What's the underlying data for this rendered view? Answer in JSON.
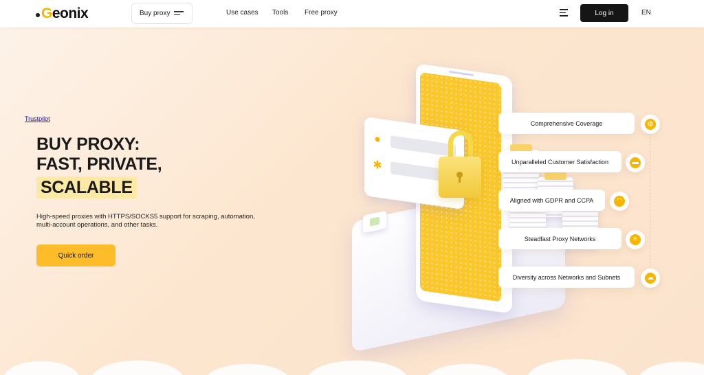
{
  "header": {
    "logo_g": "G",
    "logo_rest": "eonix",
    "buy_proxy_label": "Buy proxy",
    "nav": [
      "Use cases",
      "Tools",
      "Free proxy"
    ],
    "login_label": "Log in",
    "lang": "EN"
  },
  "hero": {
    "trustpilot": "Trustpilot",
    "title_line1": "BUY PROXY:",
    "title_line2": "FAST, PRIVATE,",
    "title_highlight": "SCALABLE",
    "description": "High-speed proxies with HTTPS/SOCKS5 support for scraping, automation, multi-account operations, and other tasks.",
    "cta_label": "Quick order"
  },
  "features": [
    {
      "label": "Comprehensive Coverage",
      "icon": "globe-icon"
    },
    {
      "label": "Unparalleled Customer Satisfaction",
      "icon": "chat-icon"
    },
    {
      "label": "Aligned with GDPR and CCPA",
      "icon": "incognito-icon"
    },
    {
      "label": "Steadfast Proxy Networks",
      "icon": "server-icon"
    },
    {
      "label": "Diversity across Networks and Subnets",
      "icon": "cloud-network-icon"
    }
  ],
  "colors": {
    "accent": "#fdbd2a",
    "dark": "#151515",
    "background": "#fde6cf"
  }
}
